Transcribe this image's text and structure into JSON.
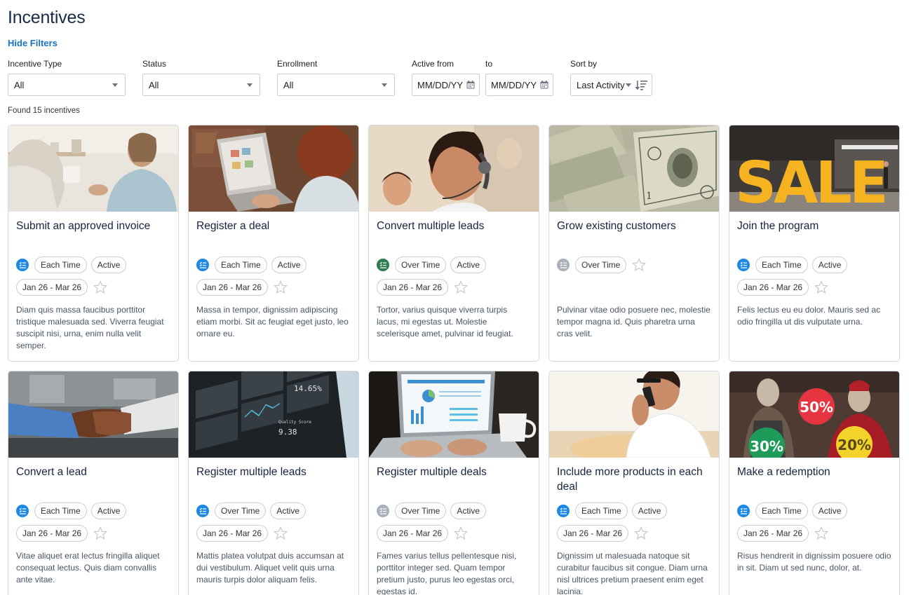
{
  "page": {
    "title": "Incentives",
    "hide_filters": "Hide Filters",
    "found": "Found 15 incentives"
  },
  "filters": {
    "incentive_type": {
      "label": "Incentive Type",
      "value": "All"
    },
    "status": {
      "label": "Status",
      "value": "All"
    },
    "enrollment": {
      "label": "Enrollment",
      "value": "All"
    },
    "active_from": {
      "label": "Active from",
      "value": "MM/DD/YY"
    },
    "to": {
      "label": "to",
      "value": "MM/DD/YY"
    },
    "sort_by": {
      "label": "Sort by",
      "value": "Last Activity"
    }
  },
  "colors": {
    "blue": "#1e88e5",
    "green": "#2e7d4f",
    "gray": "#aab1ba",
    "accent_link": "#1673c9"
  },
  "cards": [
    {
      "title": "Submit an approved invoice",
      "type_icon": "blue",
      "period": "Each Time",
      "status": "Active",
      "dates": "Jan 26 - Mar 26",
      "desc": "Diam quis massa faucibus porttitor tristique malesuada sed. Viverra feugiat suscipit nisi, urna, enim nulla velit semper."
    },
    {
      "title": "Register a deal",
      "type_icon": "blue",
      "period": "Each Time",
      "status": "Active",
      "dates": "Jan 26 - Mar 26",
      "desc": "Massa in tempor, dignissim adipiscing etiam morbi. Sit ac feugiat eget justo, leo ornare eu."
    },
    {
      "title": "Convert multiple leads",
      "type_icon": "green",
      "period": "Over Time",
      "status": "Active",
      "dates": "Jan 26 - Mar 26",
      "desc": "Tortor, varius quisque viverra turpis lacus, mi egestas ut. Molestie scelerisque amet, pulvinar id feugiat."
    },
    {
      "title": "Grow existing customers",
      "type_icon": "gray",
      "period": "Over Time",
      "status": "",
      "dates": "",
      "desc": "Pulvinar vitae odio posuere nec, molestie tempor magna id. Quis pharetra urna cras velit."
    },
    {
      "title": "Join the program",
      "type_icon": "blue",
      "period": "Each Time",
      "status": "Active",
      "dates": "Jan 26 - Mar 26",
      "desc": "Felis lectus eu eu dolor. Mauris sed ac odio fringilla ut dis vulputate urna."
    },
    {
      "title": "Convert a lead",
      "type_icon": "blue",
      "period": "Each Time",
      "status": "Active",
      "dates": "Jan 26 - Mar 26",
      "desc": "Vitae aliquet erat lectus fringilla aliquet consequat lectus. Quis diam convallis ante vitae."
    },
    {
      "title": "Register multiple leads",
      "type_icon": "blue",
      "period": "Over Time",
      "status": "Active",
      "dates": "Jan 26 - Mar 26",
      "desc": "Mattis platea volutpat duis accumsan at dui vestibulum. Aliquet velit quis urna mauris turpis dolor aliquam felis."
    },
    {
      "title": "Register multiple deals",
      "type_icon": "gray",
      "period": "Over Time",
      "status": "Active",
      "dates": "Jan 26 - Mar 26",
      "desc": "Fames varius tellus pellentesque nisi, porttitor integer sed. Quam tempor pretium justo, purus leo egestas orci, egestas id."
    },
    {
      "title": "Include more products in each deal",
      "type_icon": "blue",
      "period": "Each Time",
      "status": "Active",
      "dates": "Jan 26 - Mar 26",
      "desc": "Dignissim ut malesuada natoque sit curabitur faucibus sit congue. Diam urna nisl ultrices pretium praesent enim eget lacinia."
    },
    {
      "title": "Make a redemption",
      "type_icon": "blue",
      "period": "Each Time",
      "status": "Active",
      "dates": "Jan 26 - Mar 26",
      "desc": "Risus hendrerit in dignissim posuere odio in sit. Diam ut sed nunc, dolor, at."
    }
  ],
  "images": {
    "sale_text": "SALE",
    "pct_50": "50%",
    "pct_30": "30%",
    "pct_20": "20%",
    "screen_1": "14.65%",
    "screen_2": "Quality Score",
    "screen_3": "9.38"
  }
}
